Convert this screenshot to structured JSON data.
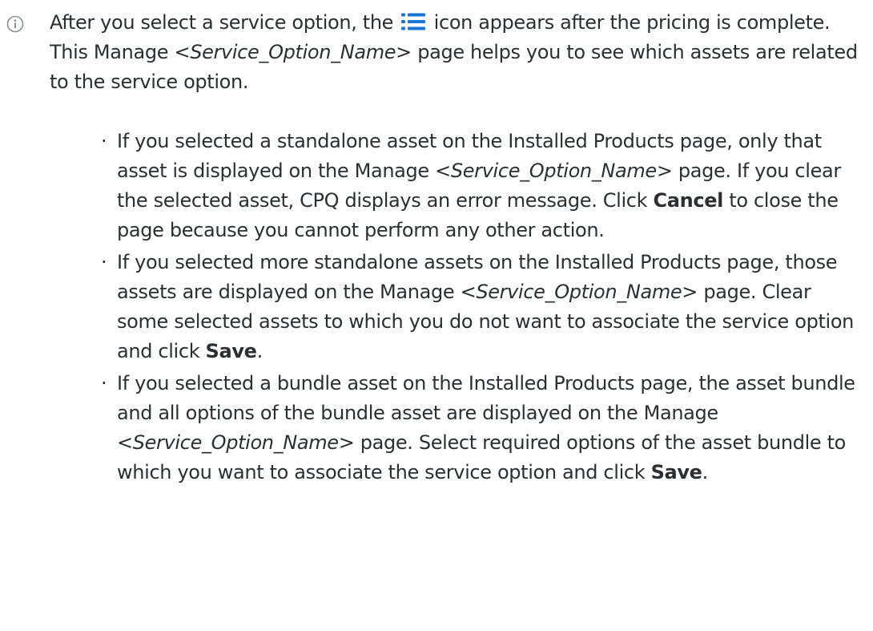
{
  "icons": {
    "info": "info-circle-icon",
    "list": "list-icon",
    "list_color": "#1b74d8",
    "info_color": "#8a8f96"
  },
  "intro": {
    "part1": "After you select a service option, the",
    "part2": "icon appears after the pricing is complete. This Manage",
    "placeholder": "<Service_Option_Name>",
    "part3": "page helps you to see which assets are related to the service option."
  },
  "bullets": [
    {
      "t1": "If you selected a standalone asset on the Installed Products page, only that asset is displayed on the Manage",
      "placeholder": "<Service_Option_Name>",
      "t2": "page. If you clear the selected asset, CPQ displays an error message. Click",
      "bold": "Cancel",
      "t3": "to close the page because you cannot perform any other action."
    },
    {
      "t1": "If you selected more standalone assets on the Installed Products page, those assets are displayed on the Manage",
      "placeholder": "<Service_Option_Name>",
      "t2": "page. Clear some selected assets to which you do not want to associate the service option and click",
      "bold": "Save",
      "t3": "."
    },
    {
      "t1": "If you selected a bundle asset on the Installed Products page, the asset bundle and all options of the bundle asset are displayed on the Manage",
      "placeholder": "<Service_Option_Name>",
      "t2": "page. Select required options of the asset bundle to which you want to associate the service option and click",
      "bold": "Save",
      "t3": "."
    }
  ]
}
